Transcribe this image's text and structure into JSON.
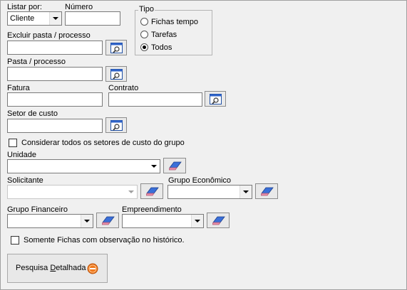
{
  "listar_por": {
    "label": "Listar por:",
    "value": "Cliente"
  },
  "numero": {
    "label": "Número",
    "value": ""
  },
  "tipo": {
    "legend": "Tipo",
    "options": [
      {
        "label": "Fichas tempo",
        "selected": false
      },
      {
        "label": "Tarefas",
        "selected": false
      },
      {
        "label": "Todos",
        "selected": true
      }
    ]
  },
  "excluir_pasta": {
    "label": "Excluir pasta / processo",
    "value": ""
  },
  "pasta": {
    "label": "Pasta / processo",
    "value": ""
  },
  "fatura": {
    "label": "Fatura",
    "value": ""
  },
  "contrato": {
    "label": "Contrato",
    "value": ""
  },
  "setor_custo": {
    "label": "Setor de custo",
    "value": ""
  },
  "considerar_setores": {
    "label": "Considerar todos os setores de custo do grupo",
    "checked": false
  },
  "unidade": {
    "label": "Unidade",
    "value": ""
  },
  "solicitante": {
    "label": "Solicitante",
    "value": ""
  },
  "grupo_economico": {
    "label": "Grupo Econômico",
    "value": ""
  },
  "grupo_financeiro": {
    "label": "Grupo Financeiro",
    "value": ""
  },
  "empreendimento": {
    "label": "Empreendimento",
    "value": ""
  },
  "somente_fichas": {
    "label": "Somente Fichas com observação no histórico.",
    "checked": false
  },
  "pesquisa": {
    "label_prefix": "Pesquisa ",
    "label_accel": "D",
    "label_rest": "etalhada"
  },
  "colors": {
    "eraser_blue": "#3a6fd8",
    "eraser_pink": "#e88ea8",
    "search_orange": "#f07a1e"
  }
}
